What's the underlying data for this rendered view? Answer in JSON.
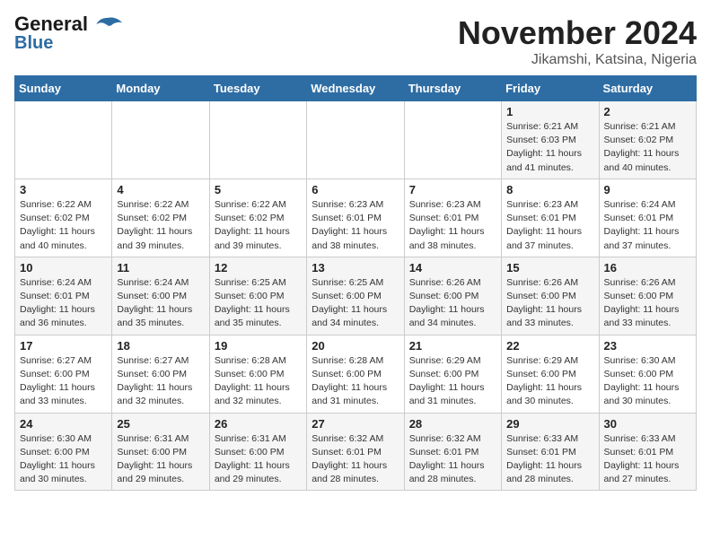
{
  "header": {
    "logo_line1": "General",
    "logo_line2": "Blue",
    "title": "November 2024",
    "subtitle": "Jikamshi, Katsina, Nigeria"
  },
  "weekdays": [
    "Sunday",
    "Monday",
    "Tuesday",
    "Wednesday",
    "Thursday",
    "Friday",
    "Saturday"
  ],
  "weeks": [
    [
      {
        "day": "",
        "text": ""
      },
      {
        "day": "",
        "text": ""
      },
      {
        "day": "",
        "text": ""
      },
      {
        "day": "",
        "text": ""
      },
      {
        "day": "",
        "text": ""
      },
      {
        "day": "1",
        "text": "Sunrise: 6:21 AM\nSunset: 6:03 PM\nDaylight: 11 hours and 41 minutes."
      },
      {
        "day": "2",
        "text": "Sunrise: 6:21 AM\nSunset: 6:02 PM\nDaylight: 11 hours and 40 minutes."
      }
    ],
    [
      {
        "day": "3",
        "text": "Sunrise: 6:22 AM\nSunset: 6:02 PM\nDaylight: 11 hours and 40 minutes."
      },
      {
        "day": "4",
        "text": "Sunrise: 6:22 AM\nSunset: 6:02 PM\nDaylight: 11 hours and 39 minutes."
      },
      {
        "day": "5",
        "text": "Sunrise: 6:22 AM\nSunset: 6:02 PM\nDaylight: 11 hours and 39 minutes."
      },
      {
        "day": "6",
        "text": "Sunrise: 6:23 AM\nSunset: 6:01 PM\nDaylight: 11 hours and 38 minutes."
      },
      {
        "day": "7",
        "text": "Sunrise: 6:23 AM\nSunset: 6:01 PM\nDaylight: 11 hours and 38 minutes."
      },
      {
        "day": "8",
        "text": "Sunrise: 6:23 AM\nSunset: 6:01 PM\nDaylight: 11 hours and 37 minutes."
      },
      {
        "day": "9",
        "text": "Sunrise: 6:24 AM\nSunset: 6:01 PM\nDaylight: 11 hours and 37 minutes."
      }
    ],
    [
      {
        "day": "10",
        "text": "Sunrise: 6:24 AM\nSunset: 6:01 PM\nDaylight: 11 hours and 36 minutes."
      },
      {
        "day": "11",
        "text": "Sunrise: 6:24 AM\nSunset: 6:00 PM\nDaylight: 11 hours and 35 minutes."
      },
      {
        "day": "12",
        "text": "Sunrise: 6:25 AM\nSunset: 6:00 PM\nDaylight: 11 hours and 35 minutes."
      },
      {
        "day": "13",
        "text": "Sunrise: 6:25 AM\nSunset: 6:00 PM\nDaylight: 11 hours and 34 minutes."
      },
      {
        "day": "14",
        "text": "Sunrise: 6:26 AM\nSunset: 6:00 PM\nDaylight: 11 hours and 34 minutes."
      },
      {
        "day": "15",
        "text": "Sunrise: 6:26 AM\nSunset: 6:00 PM\nDaylight: 11 hours and 33 minutes."
      },
      {
        "day": "16",
        "text": "Sunrise: 6:26 AM\nSunset: 6:00 PM\nDaylight: 11 hours and 33 minutes."
      }
    ],
    [
      {
        "day": "17",
        "text": "Sunrise: 6:27 AM\nSunset: 6:00 PM\nDaylight: 11 hours and 33 minutes."
      },
      {
        "day": "18",
        "text": "Sunrise: 6:27 AM\nSunset: 6:00 PM\nDaylight: 11 hours and 32 minutes."
      },
      {
        "day": "19",
        "text": "Sunrise: 6:28 AM\nSunset: 6:00 PM\nDaylight: 11 hours and 32 minutes."
      },
      {
        "day": "20",
        "text": "Sunrise: 6:28 AM\nSunset: 6:00 PM\nDaylight: 11 hours and 31 minutes."
      },
      {
        "day": "21",
        "text": "Sunrise: 6:29 AM\nSunset: 6:00 PM\nDaylight: 11 hours and 31 minutes."
      },
      {
        "day": "22",
        "text": "Sunrise: 6:29 AM\nSunset: 6:00 PM\nDaylight: 11 hours and 30 minutes."
      },
      {
        "day": "23",
        "text": "Sunrise: 6:30 AM\nSunset: 6:00 PM\nDaylight: 11 hours and 30 minutes."
      }
    ],
    [
      {
        "day": "24",
        "text": "Sunrise: 6:30 AM\nSunset: 6:00 PM\nDaylight: 11 hours and 30 minutes."
      },
      {
        "day": "25",
        "text": "Sunrise: 6:31 AM\nSunset: 6:00 PM\nDaylight: 11 hours and 29 minutes."
      },
      {
        "day": "26",
        "text": "Sunrise: 6:31 AM\nSunset: 6:00 PM\nDaylight: 11 hours and 29 minutes."
      },
      {
        "day": "27",
        "text": "Sunrise: 6:32 AM\nSunset: 6:01 PM\nDaylight: 11 hours and 28 minutes."
      },
      {
        "day": "28",
        "text": "Sunrise: 6:32 AM\nSunset: 6:01 PM\nDaylight: 11 hours and 28 minutes."
      },
      {
        "day": "29",
        "text": "Sunrise: 6:33 AM\nSunset: 6:01 PM\nDaylight: 11 hours and 28 minutes."
      },
      {
        "day": "30",
        "text": "Sunrise: 6:33 AM\nSunset: 6:01 PM\nDaylight: 11 hours and 27 minutes."
      }
    ]
  ]
}
